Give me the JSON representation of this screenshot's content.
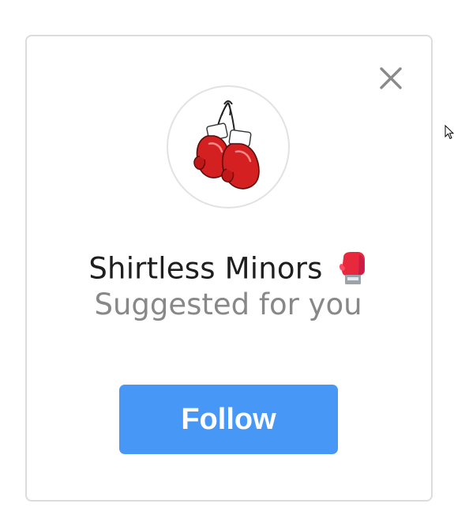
{
  "suggestion_card": {
    "name": "Shirtless Minors",
    "name_emoji": "boxing-glove-emoji",
    "subtitle": "Suggested for you",
    "follow_label": "Follow",
    "avatar_icon": "hanging-boxing-gloves",
    "close_icon": "close-icon"
  },
  "colors": {
    "follow_button": "#4797f7",
    "follow_text": "#ffffff",
    "name_text": "#1e1e1e",
    "subtitle_text": "#888888",
    "card_border": "#dcdcdc",
    "glove_red": "#d42020"
  }
}
